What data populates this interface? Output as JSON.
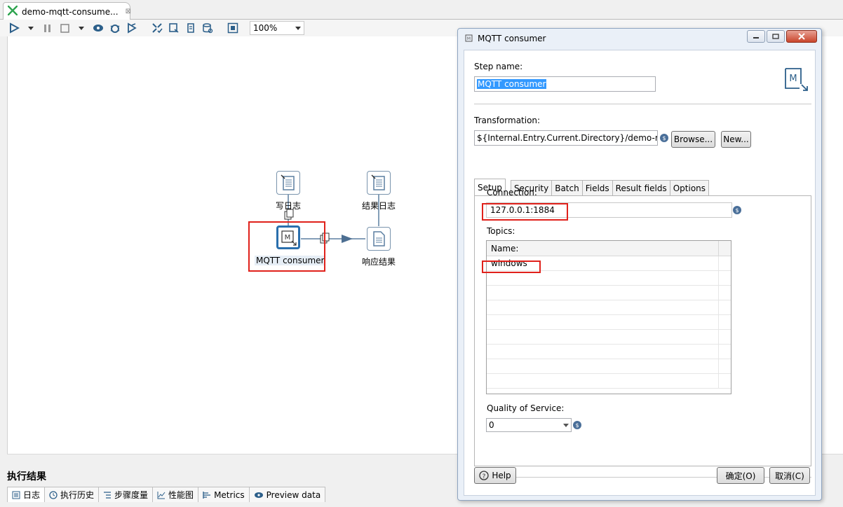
{
  "editor_tab": {
    "title": "demo-mqtt-consume...",
    "close": "⊠"
  },
  "toolbar": {
    "zoom": "100%"
  },
  "canvas": {
    "nodes": {
      "write_log": "写日志",
      "result_log": "结果日志",
      "mqtt": "MQTT consumer",
      "response": "响应结果"
    }
  },
  "results": {
    "title": "执行结果",
    "tabs": [
      "日志",
      "执行历史",
      "步骤度量",
      "性能图",
      "Metrics",
      "Preview data"
    ]
  },
  "dialog": {
    "title": "MQTT consumer",
    "step_name_label": "Step name:",
    "step_name_value": "MQTT consumer",
    "transformation_label": "Transformation:",
    "transformation_value": "${Internal.Entry.Current.Directory}/demo-mq",
    "browse_button": "Browse...",
    "new_button": "New...",
    "tabs": [
      "Setup",
      "Security",
      "Batch",
      "Fields",
      "Result fields",
      "Options"
    ],
    "connection_label": "Connection:",
    "connection_value": "127.0.0.1:1884",
    "topics_label": "Topics:",
    "topics_header": "Name:",
    "topics": [
      "windows"
    ],
    "qos_label": "Quality of Service:",
    "qos_value": "0",
    "help_button": "Help",
    "ok_button": "确定(O)",
    "cancel_button": "取消(C)"
  },
  "colors": {
    "highlight": "#e0211b",
    "selection": "#3399ff",
    "node_accent": "#2a6fad"
  }
}
